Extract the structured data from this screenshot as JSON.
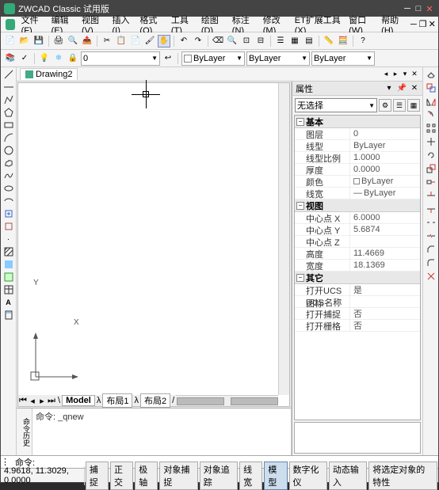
{
  "title": "ZWCAD Classic 试用版",
  "menu": [
    "文件(F)",
    "编辑(E)",
    "视图(V)",
    "插入(I)",
    "格式(O)",
    "工具(T)",
    "绘图(D)",
    "标注(N)",
    "修改(M)",
    "ET扩展工具(X)",
    "窗口(W)",
    "帮助(H)"
  ],
  "layers": {
    "current": "ByLayer",
    "linetype": "ByLayer",
    "lineweight": "ByLayer"
  },
  "doc_tab": "Drawing2",
  "model_tabs": {
    "model": "Model",
    "layout1": "布局1",
    "layout2": "布局2"
  },
  "axes": {
    "x": "X",
    "y": "Y"
  },
  "command": {
    "side": "命令历史",
    "hist": "命令: _qnew",
    "prompt": "命令:"
  },
  "props": {
    "title": "属性",
    "selection": "无选择",
    "cats": {
      "basic": "基本",
      "view": "视图",
      "other": "其它"
    },
    "rows": {
      "layer": {
        "n": "图层",
        "v": "0"
      },
      "linetype": {
        "n": "线型",
        "v": "ByLayer"
      },
      "ltscale": {
        "n": "线型比例",
        "v": "1.0000"
      },
      "thickness": {
        "n": "厚度",
        "v": "0.0000"
      },
      "color": {
        "n": "颜色",
        "v": "ByLayer"
      },
      "lineweight": {
        "n": "线宽",
        "v": "ByLayer"
      },
      "cx": {
        "n": "中心点 X",
        "v": "6.0000"
      },
      "cy": {
        "n": "中心点 Y",
        "v": "5.6874"
      },
      "cz": {
        "n": "中心点 Z",
        "v": ""
      },
      "height": {
        "n": "高度",
        "v": "11.4669"
      },
      "width": {
        "n": "宽度",
        "v": "18.1369"
      },
      "ucsicon": {
        "n": "打开UCS图标",
        "v": "是"
      },
      "ucsname": {
        "n": "UCS名称",
        "v": ""
      },
      "snap": {
        "n": "打开捕捉",
        "v": "否"
      },
      "grid": {
        "n": "打开栅格",
        "v": "否"
      }
    }
  },
  "status": {
    "coord": "4.9618, 11.3029, 0.0000",
    "btns": [
      "捕捉",
      "正交",
      "极轴",
      "对象捕捉",
      "对象追踪",
      "线宽",
      "模型",
      "数字化仪",
      "动态输入",
      "将选定对象的特性"
    ]
  }
}
